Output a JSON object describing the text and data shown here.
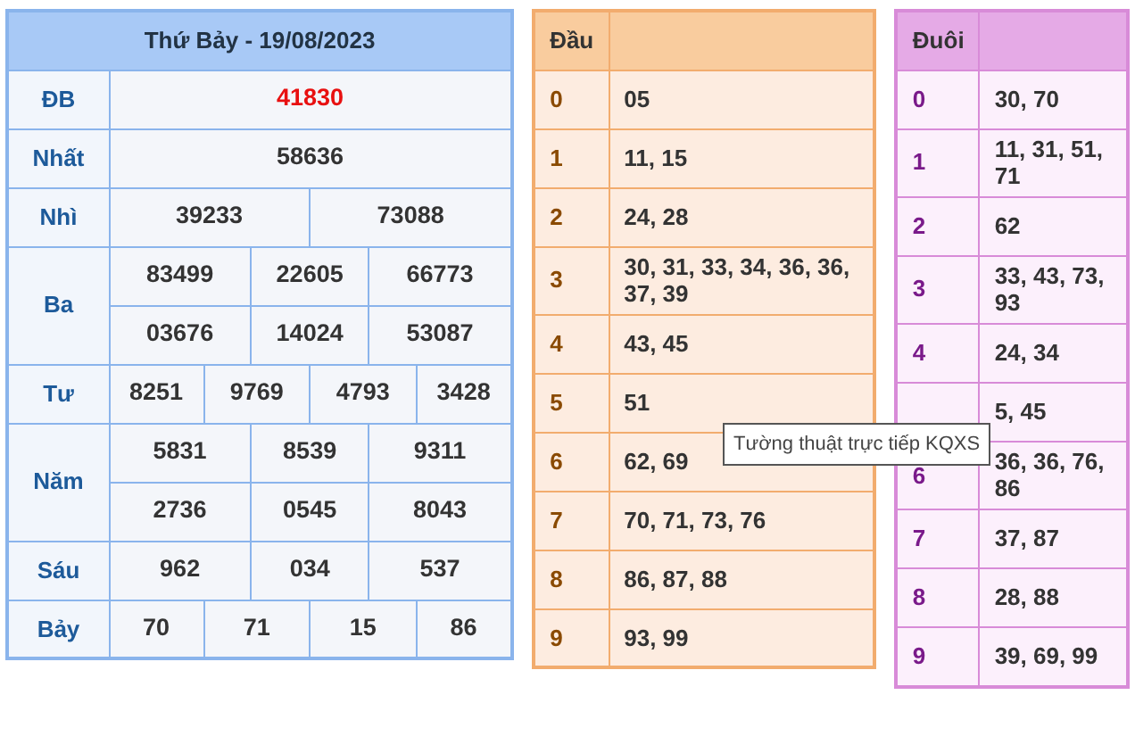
{
  "results": {
    "title": "Thứ Bảy - 19/08/2023",
    "prizes": [
      {
        "label": "ĐB",
        "kind": "special",
        "rows": [
          [
            "41830"
          ]
        ]
      },
      {
        "label": "Nhất",
        "kind": "normal",
        "rows": [
          [
            "58636"
          ]
        ]
      },
      {
        "label": "Nhì",
        "kind": "normal",
        "rows": [
          [
            "39233",
            "73088"
          ]
        ]
      },
      {
        "label": "Ba",
        "kind": "normal",
        "rows": [
          [
            "83499",
            "22605",
            "66773"
          ],
          [
            "03676",
            "14024",
            "53087"
          ]
        ]
      },
      {
        "label": "Tư",
        "kind": "normal",
        "rows": [
          [
            "8251",
            "9769",
            "4793",
            "3428"
          ]
        ]
      },
      {
        "label": "Năm",
        "kind": "normal",
        "rows": [
          [
            "5831",
            "8539",
            "9311"
          ],
          [
            "2736",
            "0545",
            "8043"
          ]
        ]
      },
      {
        "label": "Sáu",
        "kind": "normal",
        "rows": [
          [
            "962",
            "034",
            "537"
          ]
        ]
      },
      {
        "label": "Bảy",
        "kind": "normal",
        "rows": [
          [
            "70",
            "71",
            "15",
            "86"
          ]
        ]
      }
    ]
  },
  "dau": {
    "heading": "Đầu",
    "rows": [
      {
        "key": "0",
        "values": "05"
      },
      {
        "key": "1",
        "values": "11, 15"
      },
      {
        "key": "2",
        "values": "24, 28"
      },
      {
        "key": "3",
        "values": "30, 31, 33, 34, 36, 36, 37, 39"
      },
      {
        "key": "4",
        "values": "43, 45"
      },
      {
        "key": "5",
        "values": "51"
      },
      {
        "key": "6",
        "values": "62, 69"
      },
      {
        "key": "7",
        "values": "70, 71, 73, 76"
      },
      {
        "key": "8",
        "values": "86, 87, 88"
      },
      {
        "key": "9",
        "values": "93, 99"
      }
    ]
  },
  "duoi": {
    "heading": "Đuôi",
    "rows": [
      {
        "key": "0",
        "values": "30, 70"
      },
      {
        "key": "1",
        "values": "11, 31, 51, 71"
      },
      {
        "key": "2",
        "values": "62"
      },
      {
        "key": "3",
        "values": "33, 43, 73, 93"
      },
      {
        "key": "4",
        "values": "24, 34"
      },
      {
        "values": "5, 45"
      },
      {
        "key": "6",
        "values": "36, 36, 76, 86"
      },
      {
        "key": "7",
        "values": "37, 87"
      },
      {
        "key": "8",
        "values": "28, 88"
      },
      {
        "key": "9",
        "values": "39, 69, 99"
      }
    ]
  },
  "tooltip": {
    "text": "Tường thuật trực tiếp KQXS"
  }
}
